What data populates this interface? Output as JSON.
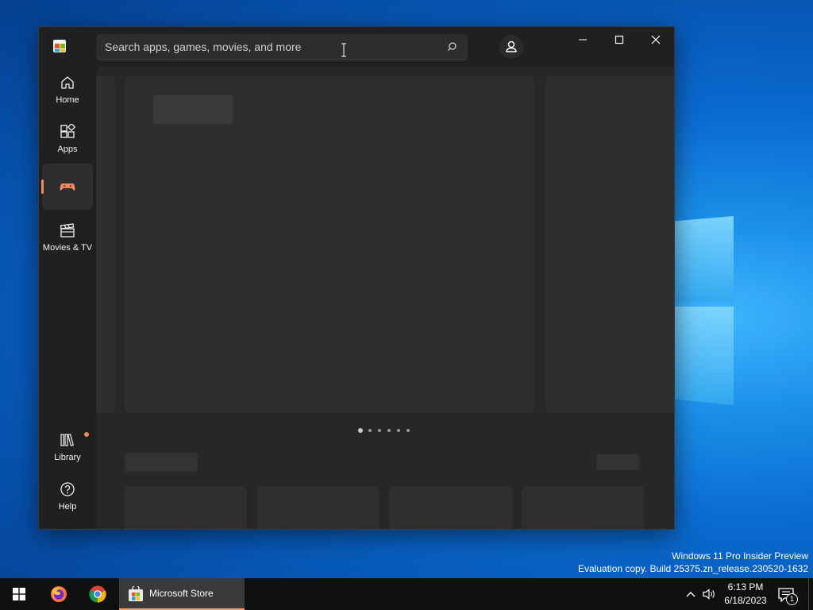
{
  "desktop": {
    "watermark": {
      "line1": "Windows 11 Pro Insider Preview",
      "line2": "Evaluation copy. Build 25375.zn_release.230520-1632"
    }
  },
  "window": {
    "search": {
      "placeholder": "Search apps, games, movies, and more",
      "value": ""
    },
    "caption": {
      "minimize": "minimize-icon",
      "maximize": "maximize-icon",
      "close": "close-icon"
    }
  },
  "sidebar": {
    "items": [
      {
        "label": "Home",
        "icon": "home-icon"
      },
      {
        "label": "Apps",
        "icon": "apps-icon"
      },
      {
        "label": "",
        "icon": "gamepad-icon",
        "active": true
      },
      {
        "label": "Movies & TV",
        "icon": "movie-clapper-icon"
      }
    ],
    "bottom": [
      {
        "label": "Library",
        "icon": "library-icon",
        "badge": true
      },
      {
        "label": "Help",
        "icon": "help-icon"
      }
    ]
  },
  "content": {
    "carousel": {
      "pages": 6,
      "current": 1
    }
  },
  "taskbar": {
    "apps": [
      {
        "name": "Start",
        "icon": "windows-start-icon"
      },
      {
        "name": "Firefox",
        "icon": "firefox-icon"
      },
      {
        "name": "Chrome",
        "icon": "chrome-icon"
      },
      {
        "name": "Microsoft Store",
        "icon": "store-icon",
        "active": true
      }
    ],
    "active_label": "Microsoft Store",
    "clock": {
      "time": "6:13 PM",
      "date": "6/18/2023"
    },
    "notifications": "1"
  },
  "colors": {
    "accent": "#f08a5d",
    "window_bg": "#202020",
    "content_bg": "#272727"
  }
}
